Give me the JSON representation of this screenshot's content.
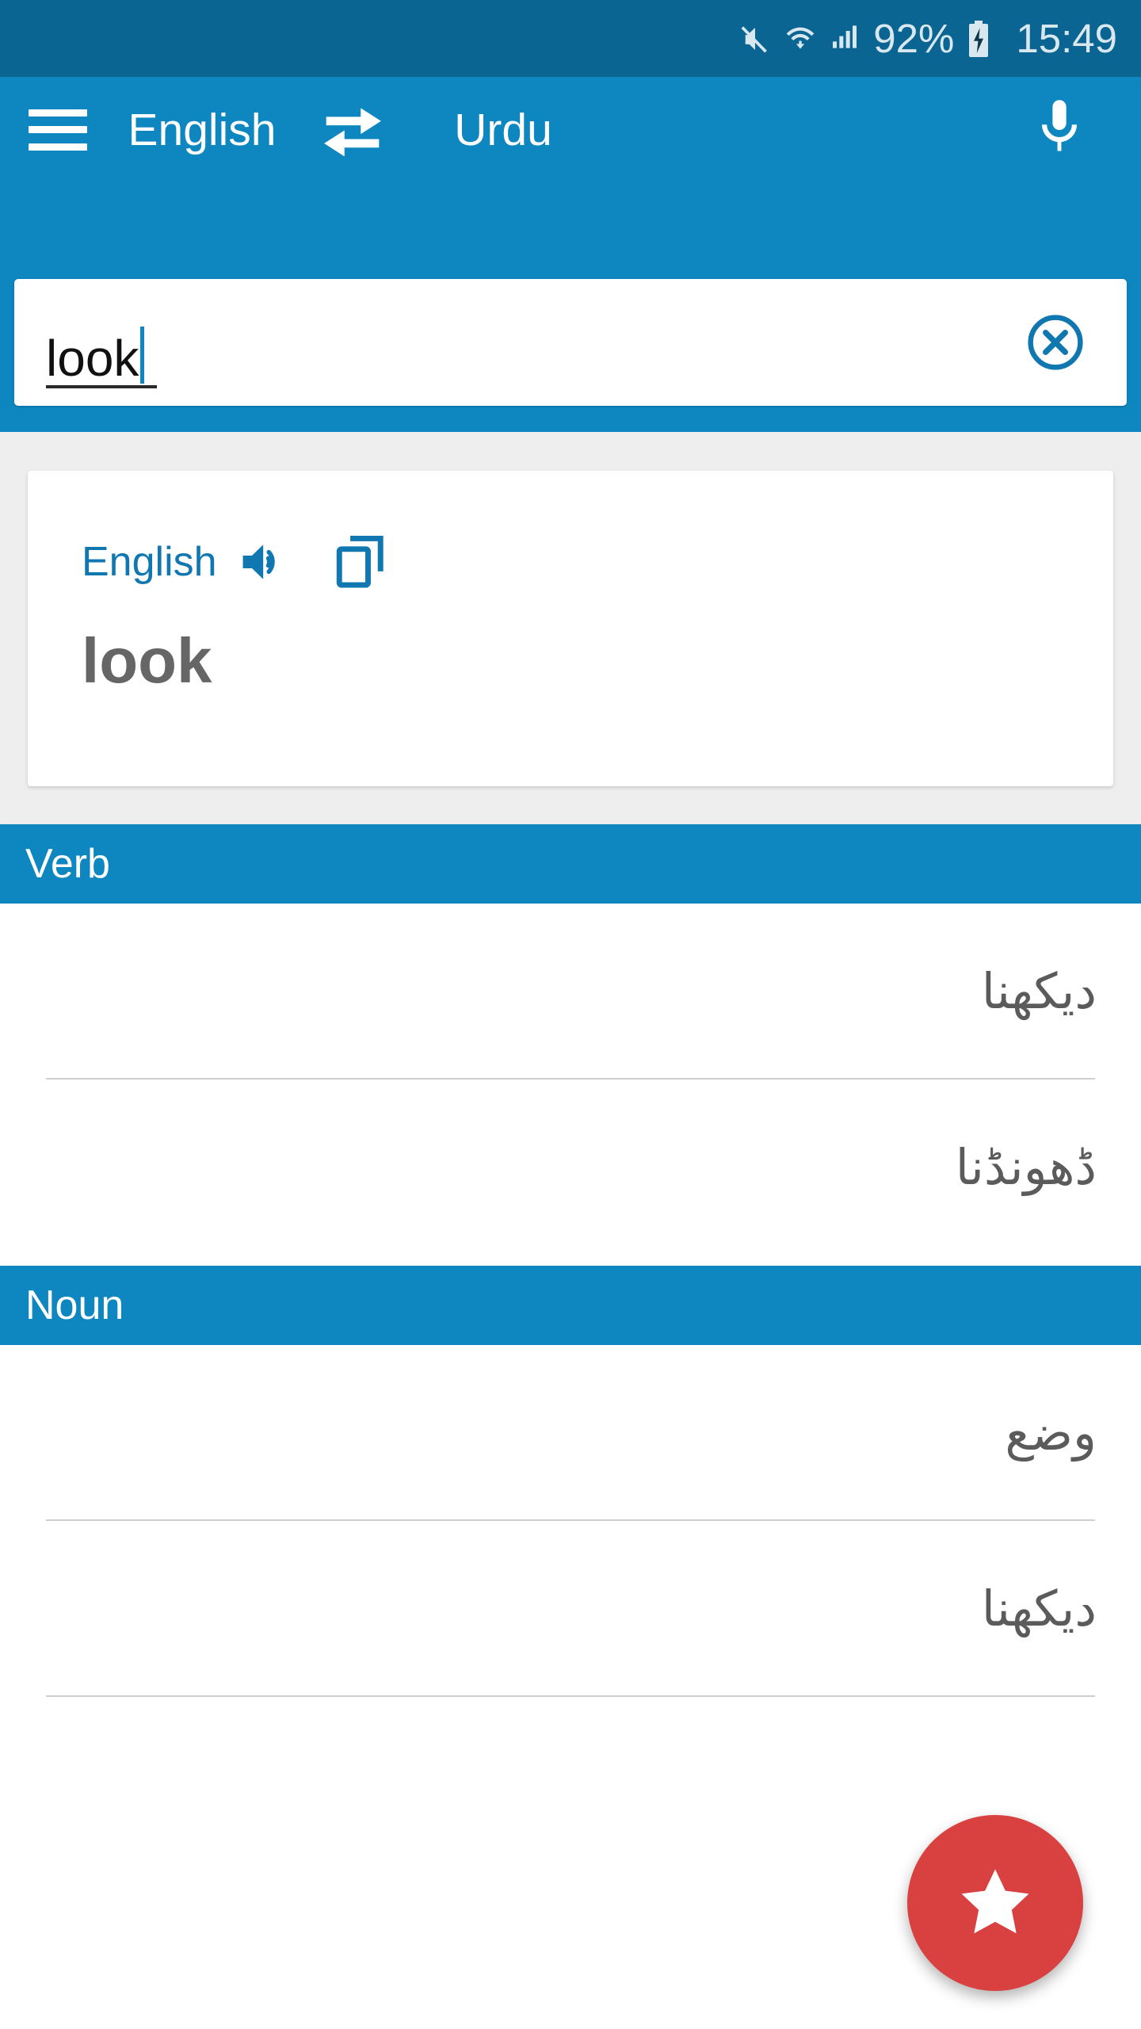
{
  "status_bar": {
    "battery_percent": "92%",
    "time": "15:49",
    "icons": [
      "mute-icon",
      "wifi-icon",
      "signal-icon",
      "battery-charging-icon"
    ],
    "background_color": "#0a6593",
    "text_color": "#d9e7ef"
  },
  "toolbar": {
    "menu_icon": "hamburger-menu-icon",
    "source_language": "English",
    "swap_icon": "swap-horizontal-icon",
    "target_language": "Urdu",
    "mic_icon": "microphone-icon",
    "background_color": "#0e86c0"
  },
  "search": {
    "value": "look",
    "placeholder": "",
    "clear_icon": "clear-circle-icon",
    "clear_color": "#1177b0"
  },
  "result_card": {
    "language_label": "English",
    "speak_icon": "speaker-icon",
    "copy_icon": "copy-icon",
    "word": "look",
    "accent_color": "#1177b0",
    "word_color": "#666666"
  },
  "sections": [
    {
      "title": "Verb",
      "entries": [
        {
          "text": "دیکھنا"
        },
        {
          "text": "ڈھونڈنا"
        }
      ]
    },
    {
      "title": "Noun",
      "entries": [
        {
          "text": "وضع"
        },
        {
          "text": "دیکھنا"
        }
      ]
    }
  ],
  "fab": {
    "icon": "star-icon",
    "color": "#d94141"
  }
}
